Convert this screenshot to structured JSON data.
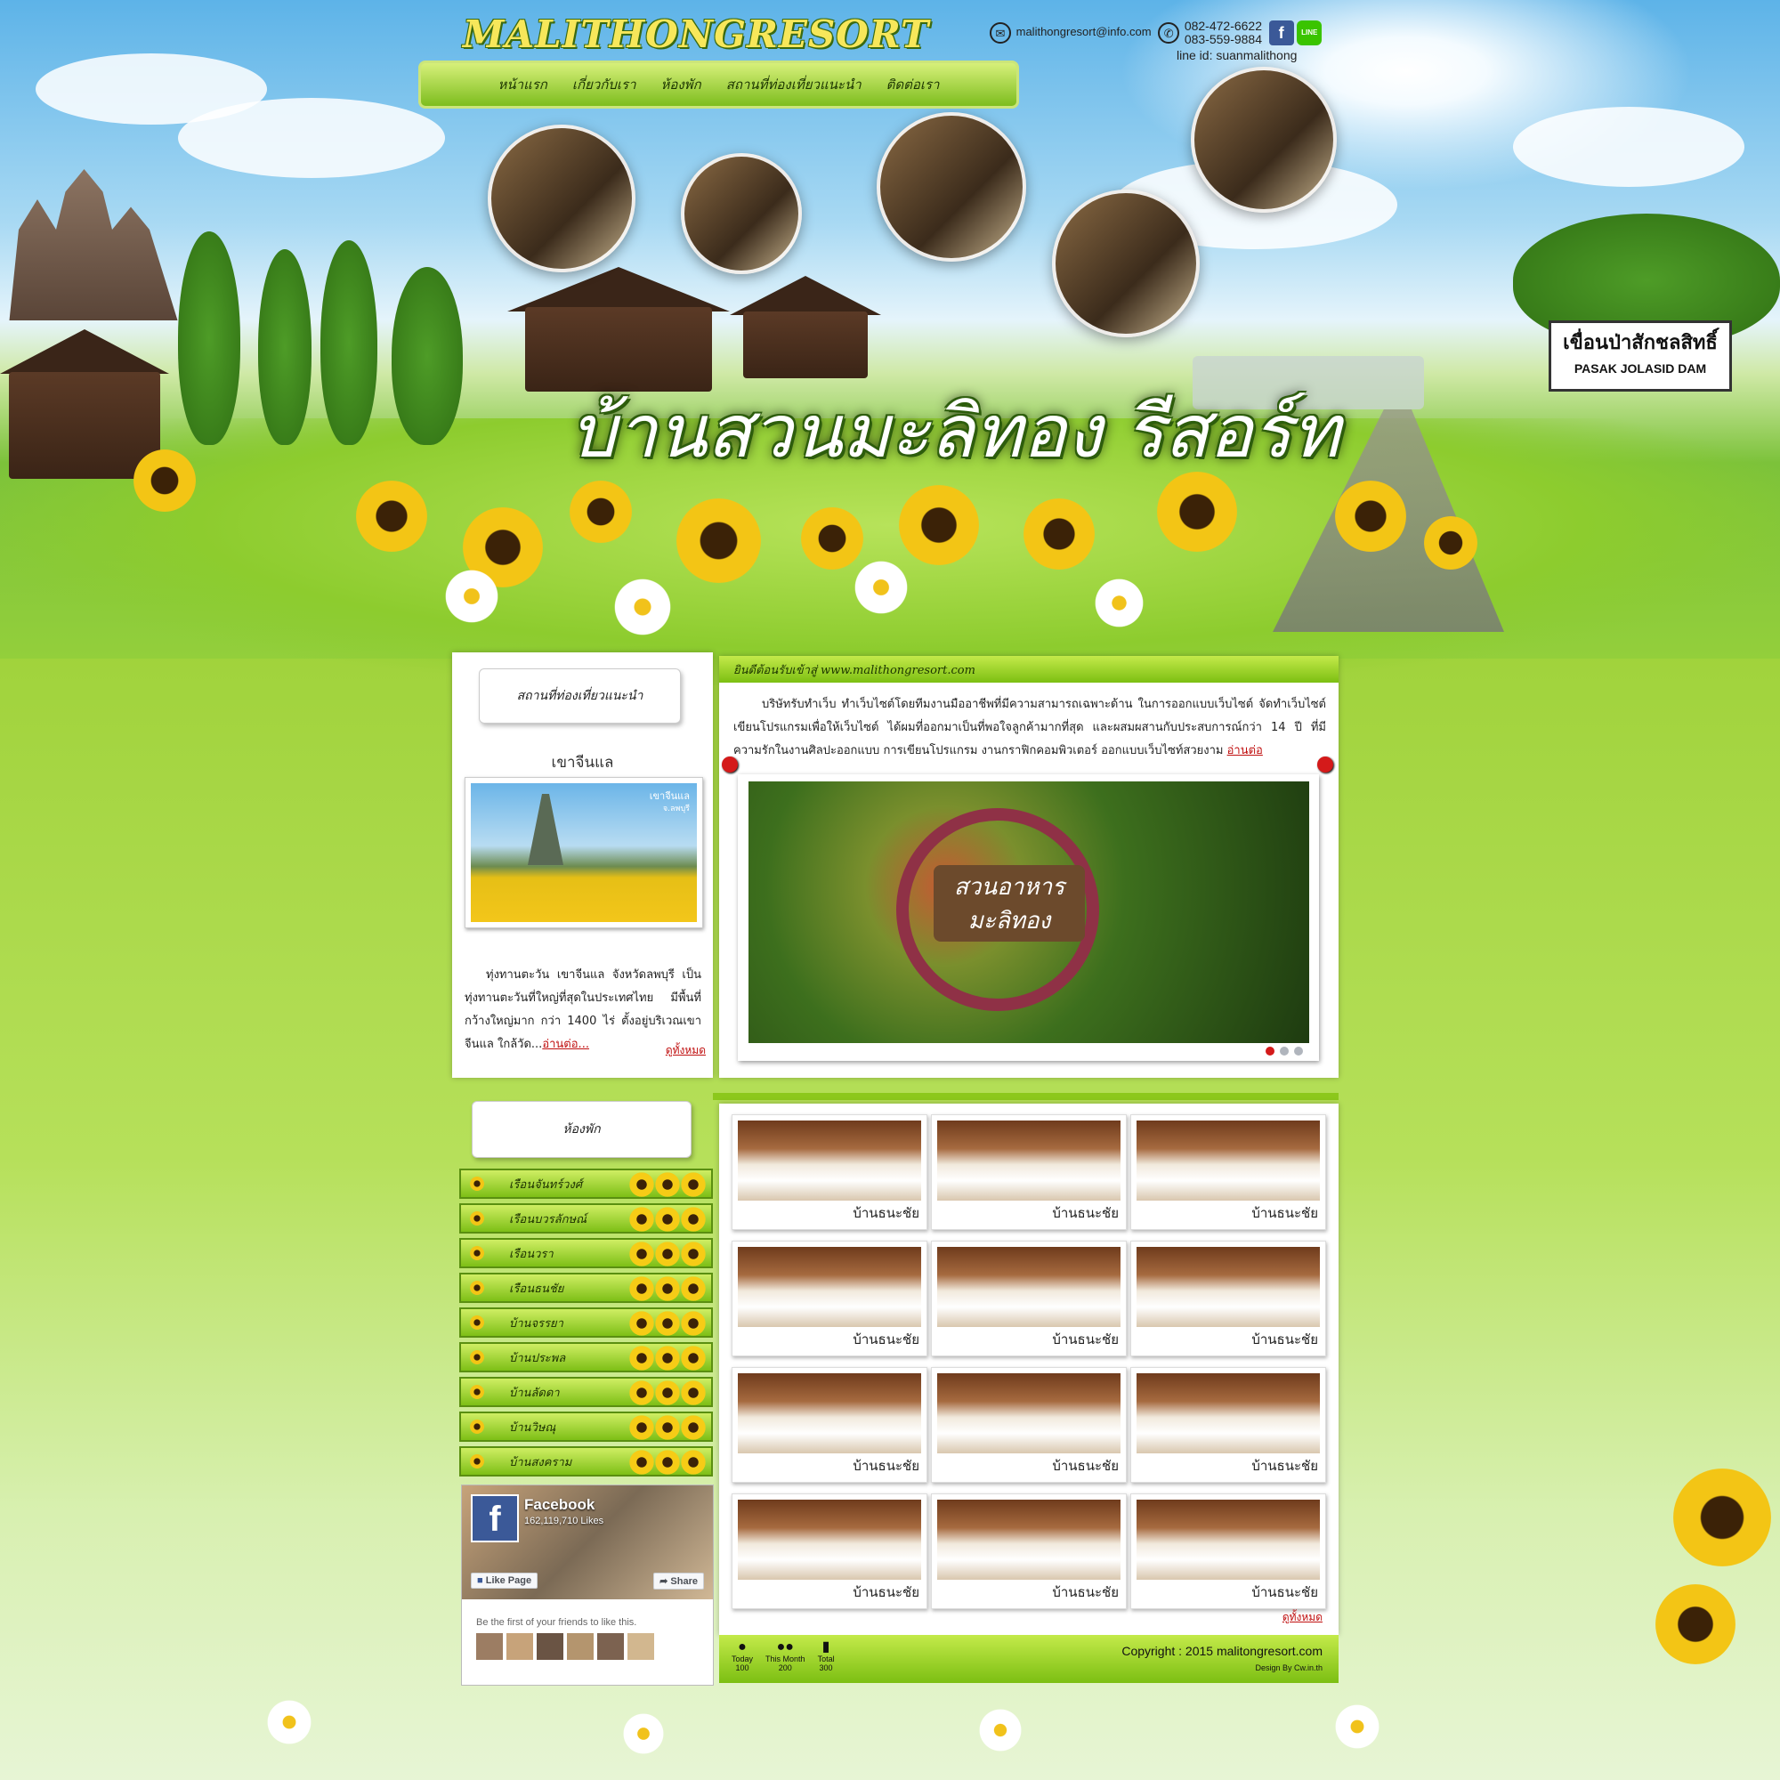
{
  "header": {
    "logo": "MALITHONGRESORT",
    "email": "malithongresort@info.com",
    "phone1": "082-472-6622",
    "phone2": "083-559-9884",
    "line_id": "line id: suanmalithong",
    "facebook_icon": "f",
    "line_icon": "LINE",
    "big_title": "บ้านสวนมะลิทอง รีสอร์ท",
    "sign_thai": "เขื่อนป่าสักชลสิทธิ์",
    "sign_en": "PASAK JOLASID DAM"
  },
  "nav": {
    "items": [
      "หน้าแรก",
      "เกี่ยวกับเรา",
      "ห้องพัก",
      "สถานที่ท่องเที่ยวแนะนำ",
      "ติดต่อเรา"
    ]
  },
  "attractions": {
    "title": "สถานที่ท่องเที่ยวแนะนำ",
    "place_name": "เขาจีนแล",
    "img_caption_1": "เขาจีนแล",
    "img_caption_2": "จ.ลพบุรี",
    "description": "ทุ่งทานตะวัน เขาจีนแล จังหวัดลพบุรี เป็นทุ่งทานตะวันที่ใหญ่ที่สุดในประเทศไทย มีพื้นที่กว้างใหญ่มาก กว่า 1400 ไร่ ตั้งอยู่บริเวณเขาจีนแล ใกล้วัด...",
    "read_more": "อ่านต่อ...",
    "view_all": "ดูทั้งหมด"
  },
  "welcome": {
    "title": "ยินดีต้อนรับเข้าสู่ www.malithongresort.com",
    "text": "บริษัทรับทำเว็บ ทำเว็บไซต์โดยทีมงานมืออาชีพที่มีความสามารถเฉพาะด้าน ในการออกแบบเว็บไซต์ จัดทำเว็บไซต์ เขียนโปรแกรมเพื่อให้เว็บไซต์ ได้ผมที่ออกมาเป็นที่พอใจลูกค้ามากที่สุด และผสมผสานกับประสบการณ์กว่า 14 ปี ที่มีความรักในงานศิลปะออกแบบ การเขียนโปรแกรม งานกราฟิกคอมพิวเตอร์ ออกแบบเว็บไซท์สวยงาม",
    "read_more": "อ่านต่อ",
    "slide_sign_line1": "สวนอาหาร",
    "slide_sign_line2": "มะลิทอง"
  },
  "rooms_menu": {
    "title": "ห้องพัก",
    "items": [
      "เรือนจันทร์วงศ์",
      "เรือนบวรลักษณ์",
      "เรือนวรา",
      "เรือนธนชัย",
      "บ้านจรรยา",
      "บ้านประพล",
      "บ้านลัดดา",
      "บ้านวิษณุ",
      "บ้านสงคราม"
    ]
  },
  "room_grid": {
    "captions": [
      "บ้านธนะชัย",
      "บ้านธนะชัย",
      "บ้านธนะชัย",
      "บ้านธนะชัย",
      "บ้านธนะชัย",
      "บ้านธนะชัย",
      "บ้านธนะชัย",
      "บ้านธนะชัย",
      "บ้านธนะชัย",
      "บ้านธนะชัย",
      "บ้านธนะชัย",
      "บ้านธนะชัย"
    ],
    "view_all": "ดูทั้งหมด"
  },
  "facebook": {
    "name": "Facebook",
    "likes": "162,119,710 Likes",
    "like_btn": "Like Page",
    "share_btn": "Share",
    "friends_text": "Be the first of your friends to like this."
  },
  "footer": {
    "stats": [
      {
        "label": "Today",
        "value": "100"
      },
      {
        "label": "This Month",
        "value": "200"
      },
      {
        "label": "Total",
        "value": "300"
      }
    ],
    "copyright": "Copyright : 2015 malitongresort.com",
    "design_by": "Design By Cw.in.th"
  },
  "colors": {
    "accent_green": "#7cbf12",
    "link_red": "#c01010",
    "facebook_blue": "#3b5998"
  }
}
